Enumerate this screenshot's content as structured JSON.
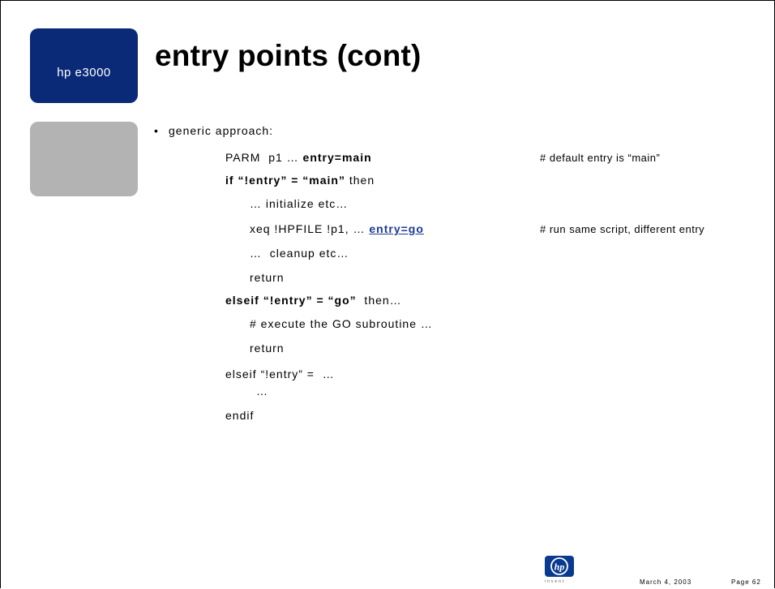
{
  "brand": {
    "label": "hp e3000",
    "color": "#0a2a78",
    "logo_tagline": "invent"
  },
  "title": "entry points (cont)",
  "bullet": "generic approach:",
  "code": {
    "line1_a": "PARM  p1 … ",
    "line1_b": "entry=main",
    "line2_a": "if “!entry” = “main”",
    "line2_b": " then",
    "line3": "… initialize etc…",
    "line4_a": "xeq !HPFILE !p1, … ",
    "line4_link": "entry=go",
    "line5": "…  cleanup etc…",
    "line6": "return",
    "line7_a": "elseif “!entry” = “go”",
    "line7_b": "  then…",
    "line8": "# execute the GO subroutine …",
    "line9": "return",
    "line10": "elseif “!entry” =  …",
    "line11": "…",
    "line12": "endif"
  },
  "comments": {
    "c1": "# default entry is “main”",
    "c2": "# run same script, different entry"
  },
  "footer": {
    "date": "March 4, 2003",
    "page": "Page 62"
  },
  "colors": {
    "link": "#1b3a96",
    "side_box": "#b3b3b3"
  }
}
